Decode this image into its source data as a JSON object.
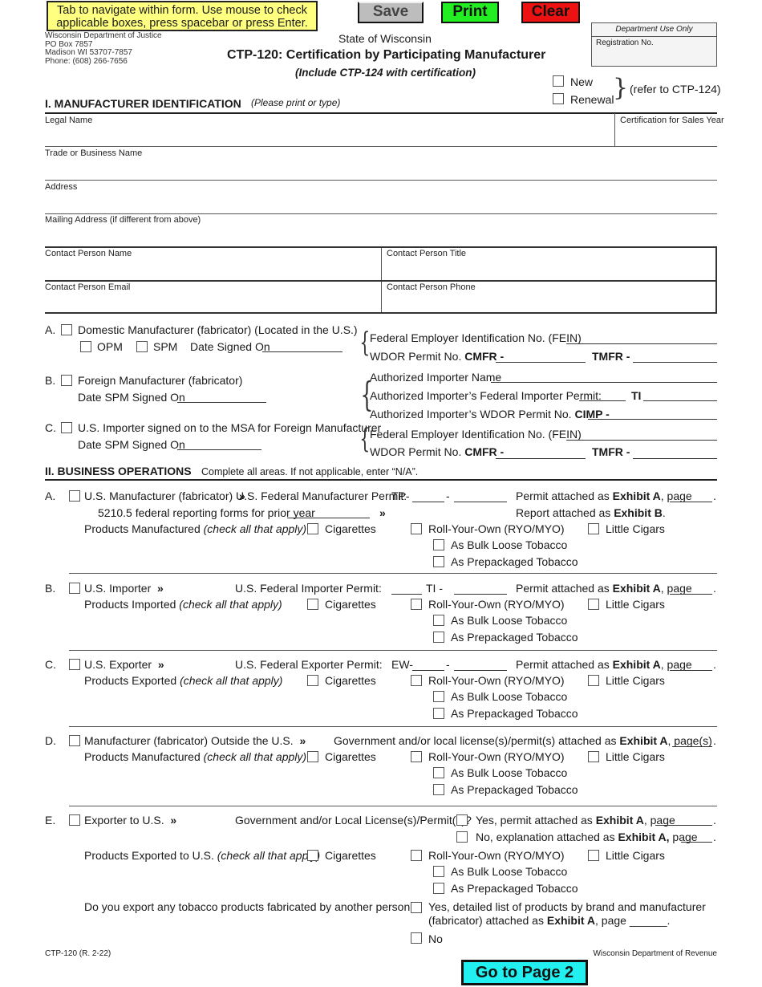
{
  "toolbar": {
    "notice": "Tab to navigate within form. Use mouse to check applicable boxes, press spacebar or press Enter.",
    "save_label": "Save",
    "print_label": "Print",
    "clear_label": "Clear",
    "next_page_label": "Go to Page 2",
    "colors": {
      "notice_bg": "#ffff80",
      "save": "#bdbdbd",
      "print": "#22ee22",
      "clear": "#ee1111",
      "next_page": "#22f0f0"
    }
  },
  "header": {
    "agency": [
      "Wisconsin Department of Justice",
      "PO Box 7857",
      "Madison WI  53707-7857",
      "Phone:  (608) 266-7656"
    ],
    "state": "State of Wisconsin",
    "title": "CTP-120:  Certification by Participating Manufacturer",
    "subtitle": "(Include CTP-124 with certification)",
    "dept_use_only": "Department Use Only",
    "registration_no_label": "Registration No.",
    "registration_no_value": "",
    "new_label": "New",
    "renewal_label": "Renewal",
    "refer_note": "(refer to CTP-124)"
  },
  "section1": {
    "heading": "I.  MANUFACTURER IDENTIFICATION",
    "subheading": "(Please print or type)",
    "fields": {
      "legal_name": {
        "label": "Legal Name",
        "value": ""
      },
      "sales_year": {
        "label": "Certification for Sales Year",
        "value": ""
      },
      "trade_name": {
        "label": "Trade or Business Name",
        "value": ""
      },
      "address": {
        "label": "Address",
        "value": ""
      },
      "mailing_address": {
        "label": "Mailing Address (if different from above)",
        "value": ""
      },
      "contact_name": {
        "label": "Contact Person Name",
        "value": ""
      },
      "contact_title": {
        "label": "Contact Person Title",
        "value": ""
      },
      "contact_email": {
        "label": "Contact Person Email",
        "value": ""
      },
      "contact_phone": {
        "label": "Contact Person Phone",
        "value": ""
      }
    },
    "type_a": {
      "letter": "A.",
      "label": "Domestic Manufacturer (fabricator) (Located in the U.S.)",
      "opm": "OPM",
      "spm": "SPM",
      "date_label": "Date Signed On"
    },
    "type_b": {
      "letter": "B.",
      "label": "Foreign Manufacturer (fabricator)",
      "date_label": "Date SPM Signed On"
    },
    "type_c": {
      "letter": "C.",
      "label": "U.S. Importer signed on to the MSA for Foreign Manufacturer",
      "date_label": "Date SPM Signed On"
    },
    "fein_label": "Federal Employer Identification No. (FEIN)",
    "wdor_label": "WDOR Permit No.",
    "cmfr": "CMFR -",
    "tmfr": "TMFR -",
    "importer_name_label": "Authorized Importer Name",
    "importer_fed_permit_label": "Authorized Importer’s Federal Importer Permit:",
    "ti": "TI",
    "importer_wdor_label": "Authorized Importer’s WDOR Permit No.",
    "cimp": "CIMP -"
  },
  "section2": {
    "heading": "II.  BUSINESS OPERATIONS",
    "instructions": "Complete all areas. If not applicable, enter “N/A”.",
    "products": {
      "cigarettes": "Cigarettes",
      "ryo": "Roll-Your-Own (RYO/MYO)",
      "little_cigars": "Little Cigars",
      "bulk": "As Bulk Loose Tobacco",
      "prepack": "As Prepackaged Tobacco",
      "check_all": "(check all that apply)"
    },
    "a": {
      "letter": "A.",
      "label": "U.S. Manufacturer (fabricator)",
      "arrow": "»",
      "permit_label": "U.S. Federal Manufacturer Permit:",
      "permit_prefix": "TP-",
      "dash": "-",
      "attached": "Permit attached as",
      "exhibit": "Exhibit A",
      "page": ", page",
      "forms_label": "5210.5 federal reporting forms for prior year",
      "report_attached": "Report attached as",
      "exhibit_b": "Exhibit B",
      "products_label": "Products Manufactured"
    },
    "b": {
      "letter": "B.",
      "label": "U.S. Importer",
      "arrow": "»",
      "permit_label": "U.S. Federal Importer Permit:",
      "permit_prefix": "TI -",
      "attached": "Permit attached as",
      "exhibit": "Exhibit A",
      "page": ", page",
      "products_label": "Products Imported"
    },
    "c": {
      "letter": "C.",
      "label": "U.S. Exporter",
      "arrow": "»",
      "permit_label": "U.S. Federal Exporter Permit:",
      "permit_prefix": "EW-",
      "dash": "-",
      "attached": "Permit attached as",
      "exhibit": "Exhibit A",
      "page": ", page",
      "products_label": "Products Exported"
    },
    "d": {
      "letter": "D.",
      "label": "Manufacturer (fabricator) Outside the U.S.",
      "arrow": "»",
      "license_label": "Government and/or local license(s)/permit(s) attached as",
      "exhibit": "Exhibit A",
      "pages": ", page(s)",
      "products_label": "Products Manufactured"
    },
    "e": {
      "letter": "E.",
      "label": "Exporter to U.S.",
      "arrow": "»",
      "license_q": "Government and/or Local License(s)/Permit(s)?",
      "yes_label": "Yes, permit attached as",
      "exhibit": "Exhibit A",
      "page": ", page",
      "no_label": "No, explanation attached as",
      "exhibit_comma": "Exhibit A,",
      "page2": " page",
      "products_label": "Products Exported to U.S.",
      "other_q": "Do you export any tobacco products fabricated by another person?",
      "other_yes_1": "Yes, detailed list of products by brand and manufacturer",
      "other_yes_2a": "(fabricator) attached as",
      "other_yes_2b": ", page ______.",
      "other_no": "No"
    }
  },
  "footer": {
    "form_id": "CTP-120 (R. 2-22)",
    "agency": "Wisconsin Department of Revenue"
  }
}
